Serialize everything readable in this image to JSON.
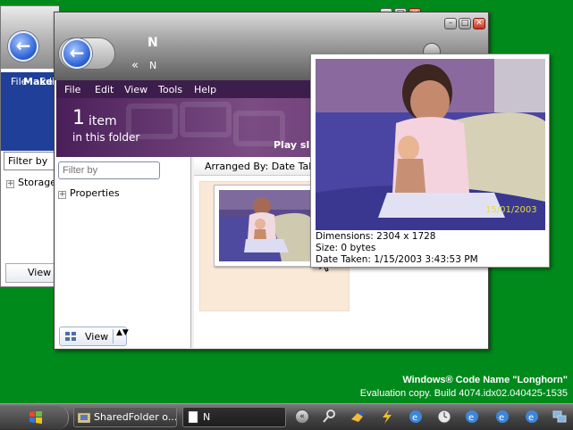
{
  "back_window": {
    "menu_file": "File",
    "menu_edit": "Edi",
    "make_label": "Make",
    "filter_placeholder": "Filter by",
    "tree_item": "Storage",
    "view_label": "View"
  },
  "window": {
    "title": "N",
    "path_chevron": "«",
    "path_current": "N",
    "minimize_symbol": "–",
    "maximize_symbol": "□",
    "close_symbol": "✕"
  },
  "menubar": {
    "items": [
      "File",
      "Edit",
      "View",
      "Tools",
      "Help"
    ]
  },
  "banner": {
    "count": "1",
    "count_unit": "item",
    "count_desc": "in this folder",
    "play_label": "Play sli"
  },
  "left_pane": {
    "filter_placeholder": "Filter by",
    "properties_label": "Properties",
    "expander_symbol": "+",
    "view_label": "View",
    "view_arrows": "▲▼"
  },
  "content": {
    "arranged_by": "Arranged By: Date Taken"
  },
  "preview": {
    "photo_stamp": "15/01/2003",
    "dimensions": "Dimensions: 2304 x 1728",
    "size": "Size: 0 bytes",
    "date_taken": "Date Taken: 1/15/2003 3:43:53 PM"
  },
  "watermark": {
    "title": "Windows® Code Name \"Longhorn\"",
    "build": "Evaluation copy. Build 4074.idx02.040425-1535"
  },
  "taskbar": {
    "buttons": [
      {
        "label": "SharedFolder o...",
        "icon": "folder-icon"
      },
      {
        "label": "N",
        "icon": "document-icon"
      }
    ],
    "tray_expand_symbol": "«",
    "tray_icons": [
      "search-icon",
      "network-icon",
      "lightning-icon",
      "ie-icon",
      "clock-icon",
      "ie-icon",
      "ie-icon",
      "ie-icon",
      "network-icon"
    ]
  }
}
